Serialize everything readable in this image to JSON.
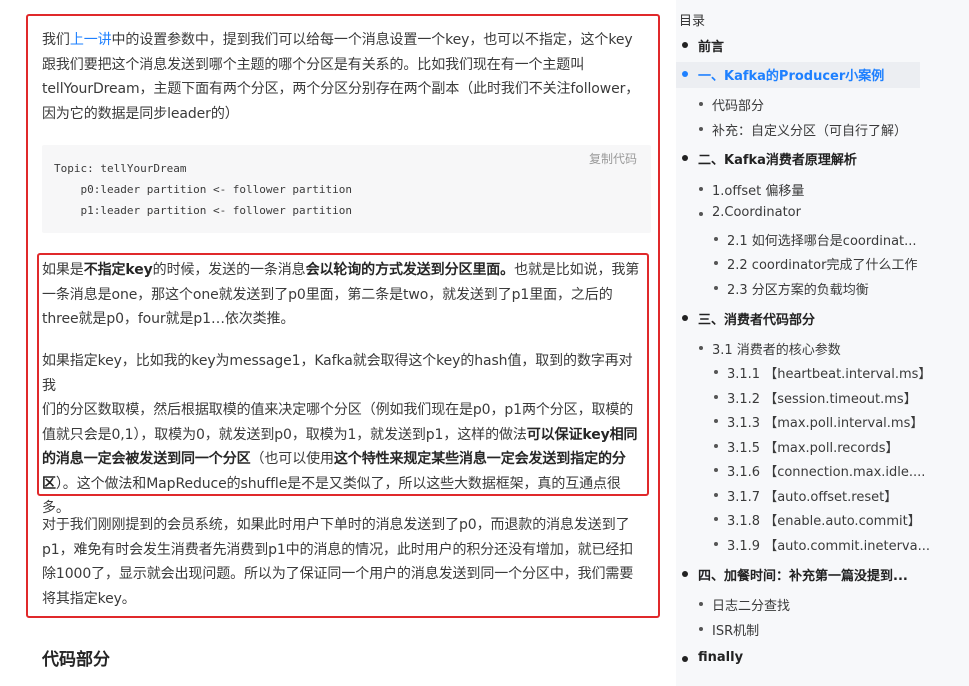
{
  "article": {
    "p1": {
      "a": "我们",
      "link": "上一讲",
      "b": "中的设置参数中，提到我们可以给每一个消息设置一个key，也可以不指定，这个key",
      "lines": [
        "跟我们要把这个消息发送到哪个主题的哪个分区是有关系的。比如我们现在有一个主题叫",
        "tellYourDream，主题下面有两个分区，两个分区分别存在两个副本（此时我们不关注follower，",
        "因为它的数据是同步leader的）"
      ]
    },
    "code": {
      "copy_label": "复制代码",
      "lines": [
        "Topic: tellYourDream",
        "    p0:leader partition <- follower partition",
        "    p1:leader partition <- follower partition"
      ]
    },
    "p2": {
      "l1a": "如果是",
      "l1b": "不指定key",
      "l1c": "的时候，发送的一条消息",
      "l1d": "会以轮询的方式发送到分区里面。",
      "l1e": "也就是比如说，我第",
      "l2": "一条消息是one，那这个one就发送到了p0里面，第二条是two，就发送到了p1里面，之后的",
      "l3": "three就是p0，four就是p1…依次类推。"
    },
    "p3": {
      "l1": "如果指定key，比如我的key为message1，Kafka就会取得这个key的hash值，取到的数字再对我",
      "l2": "们的分区数取模，然后根据取模的值来决定哪个分区（例如我们现在是p0，p1两个分区，取模的",
      "l3a": "值就只会是0,1），取模为0，就发送到p0，取模为1，就发送到p1，这样的做法",
      "l3b": "可以保证key相同",
      "l4a": "的消息一定会被发送到同一个分区",
      "l4b": "（也可以使用",
      "l4c": "这个特性来规定某些消息一定会发送到指定的分",
      "l5a": "区",
      "l5b": "）。这个做法和MapReduce的shuffle是不是又类似了，所以这些大数据框架，真的互通点很",
      "l6": "多。"
    },
    "p4": {
      "lines": [
        "对于我们刚刚提到的会员系统，如果此时用户下单时的消息发送到了p0，而退款的消息发送到了",
        "p1，难免有时会发生消费者先消费到p1中的消息的情况，此时用户的积分还没有增加，就已经扣",
        "除1000了，显示就会出现问题。所以为了保证同一个用户的消息发送到同一个分区中，我们需要",
        "将其指定key。"
      ]
    },
    "section_heading": "代码部分"
  },
  "toc": {
    "title": "目录",
    "items": [
      {
        "label": "前言",
        "level": 1
      },
      {
        "label": "一、Kafka的Producer小案例",
        "level": 1,
        "active": true
      },
      {
        "label": "代码部分",
        "level": 2
      },
      {
        "label": "补充：自定义分区（可自行了解）",
        "level": 2
      },
      {
        "label": "二、Kafka消费者原理解析",
        "level": 1
      },
      {
        "label": "1.offset 偏移量",
        "level": 2
      },
      {
        "label": "2.Coordinator",
        "level": 2
      },
      {
        "label": "2.1 如何选择哪台是coordinat...",
        "level": 3
      },
      {
        "label": "2.2 coordinator完成了什么工作",
        "level": 3
      },
      {
        "label": "2.3 分区方案的负载均衡",
        "level": 3
      },
      {
        "label": "三、消费者代码部分",
        "level": 1
      },
      {
        "label": "3.1 消费者的核心参数",
        "level": 2
      },
      {
        "label": "3.1.1 【heartbeat.interval.ms】",
        "level": 3
      },
      {
        "label": "3.1.2 【session.timeout.ms】",
        "level": 3
      },
      {
        "label": "3.1.3 【max.poll.interval.ms】",
        "level": 3
      },
      {
        "label": "3.1.5 【max.poll.records】",
        "level": 3
      },
      {
        "label": "3.1.6 【connection.max.idle....",
        "level": 3
      },
      {
        "label": "3.1.7 【auto.offset.reset】",
        "level": 3
      },
      {
        "label": "3.1.8 【enable.auto.commit】",
        "level": 3
      },
      {
        "label": "3.1.9 【auto.commit.ineterva...",
        "level": 3
      },
      {
        "label": "四、加餐时间：补充第一篇没提到...",
        "level": 1
      },
      {
        "label": "日志二分查找",
        "level": 2
      },
      {
        "label": "ISR机制",
        "level": 2
      },
      {
        "label": "finally",
        "level": 1
      }
    ]
  },
  "colors": {
    "accent": "#1e80ff",
    "highlight_border": "#e0292b"
  }
}
